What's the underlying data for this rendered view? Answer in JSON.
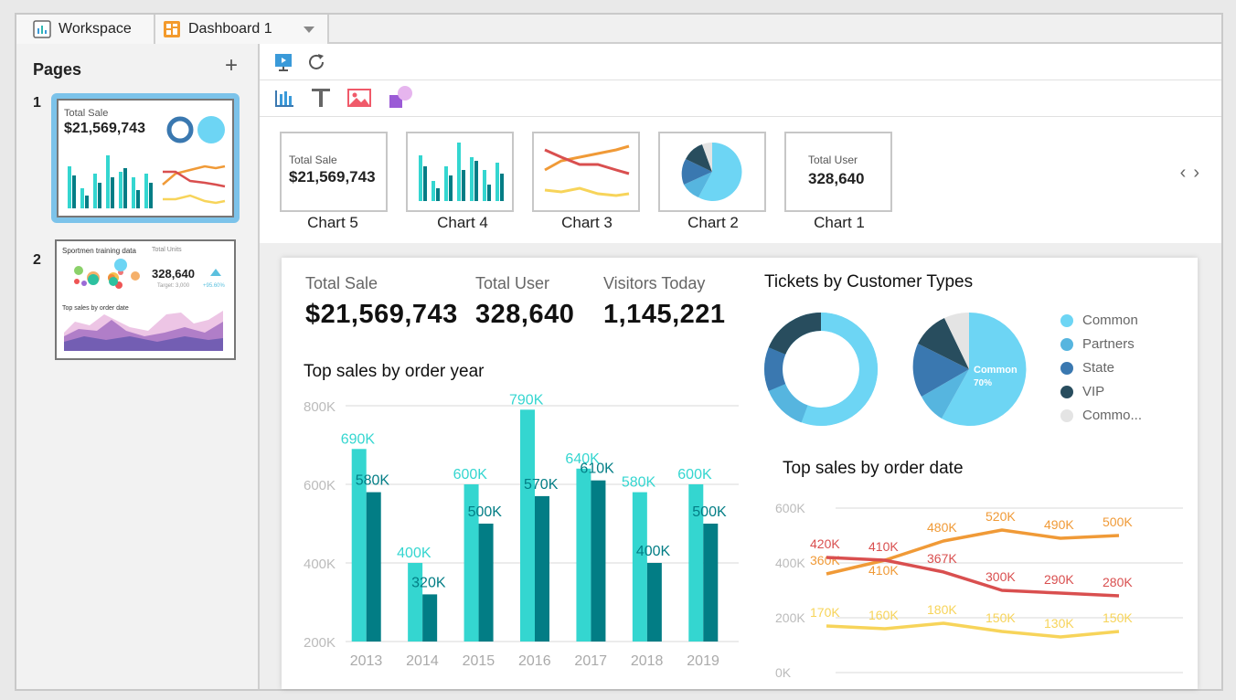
{
  "tabs": [
    {
      "label": "Workspace",
      "icon": "workspace-icon"
    },
    {
      "label": "Dashboard 1",
      "icon": "dashboard-icon"
    }
  ],
  "sidebar": {
    "title": "Pages",
    "pages": [
      {
        "number": "1",
        "thumb": {
          "label": "Total Sale",
          "value": "$21,569,743"
        }
      },
      {
        "number": "2",
        "thumb": {
          "title1": "Sportmen training data",
          "label": "Total Units",
          "value": "328,640",
          "target": "Target: 3,000",
          "delta": "+95.60%",
          "title2": "Top sales by order date"
        }
      }
    ]
  },
  "toolbar": {
    "row1": [
      "present-icon",
      "refresh-icon"
    ],
    "row2": [
      "chart-icon",
      "text-icon",
      "image-icon",
      "shape-icon"
    ]
  },
  "widgets": [
    {
      "name": "Chart 5",
      "label": "Total Sale",
      "value": "$21,569,743"
    },
    {
      "name": "Chart 4"
    },
    {
      "name": "Chart 3"
    },
    {
      "name": "Chart 2"
    },
    {
      "name": "Chart 1",
      "label": "Total User",
      "value": "328,640"
    }
  ],
  "kpis": [
    {
      "label": "Total Sale",
      "value": "$21,569,743"
    },
    {
      "label": "Total User",
      "value": "328,640"
    },
    {
      "label": "Visitors Today",
      "value": "1,145,221"
    }
  ],
  "tickets": {
    "title": "Tickets by Customer Types",
    "legend": [
      {
        "name": "Common",
        "color": "#6dd5f4"
      },
      {
        "name": "Partners",
        "color": "#56b5df"
      },
      {
        "name": "State",
        "color": "#3a78b0"
      },
      {
        "name": "VIP",
        "color": "#284d5e"
      },
      {
        "name": "Commo...",
        "color": "#e4e4e4"
      }
    ],
    "pie_label": "Common",
    "pie_pct": "70%"
  },
  "colors": {
    "teal": "#34d6d0",
    "dark_teal": "#027d85",
    "orange": "#f09a37",
    "red": "#d94f4f",
    "yellow": "#f7d45a"
  },
  "chart_data": [
    {
      "type": "bar",
      "title": "Top sales by order year",
      "categories": [
        "2013",
        "2014",
        "2015",
        "2016",
        "2017",
        "2018",
        "2019"
      ],
      "series": [
        {
          "values": [
            690,
            400,
            600,
            790,
            640,
            580,
            600
          ],
          "labels": [
            "690K",
            "400K",
            "600K",
            "790K",
            "640K",
            "580K",
            "600K"
          ]
        },
        {
          "values": [
            580,
            320,
            500,
            570,
            610,
            400,
            500
          ],
          "labels": [
            "580K",
            "320K",
            "500K",
            "570K",
            "610K",
            "400K",
            "500K"
          ]
        }
      ],
      "yticks": [
        "800K",
        "600K",
        "400K",
        "200K"
      ],
      "ylim": [
        200,
        800
      ],
      "grid": true
    },
    {
      "type": "line",
      "title": "Top sales by order date",
      "series": [
        {
          "values": [
            360,
            410,
            480,
            520,
            490,
            500
          ],
          "labels": [
            "360K",
            "410K",
            "480K",
            "520K",
            "490K",
            "500K"
          ]
        },
        {
          "values": [
            420,
            410,
            367,
            300,
            290,
            280
          ],
          "labels": [
            "420K",
            "410K",
            "367K",
            "300K",
            "290K",
            "280K"
          ]
        },
        {
          "values": [
            170,
            160,
            180,
            150,
            130,
            150
          ],
          "labels": [
            "170K",
            "160K",
            "180K",
            "150K",
            "130K",
            "150K"
          ]
        }
      ],
      "yticks": [
        "600K",
        "400K",
        "200K",
        "0K"
      ],
      "ylim": [
        0,
        600
      ],
      "grid": true
    },
    {
      "type": "pie",
      "title": "Tickets by Customer Types",
      "categories": [
        "Common",
        "Partners",
        "State",
        "VIP",
        "Commo..."
      ],
      "values": [
        70,
        8,
        10,
        8,
        4
      ]
    }
  ]
}
